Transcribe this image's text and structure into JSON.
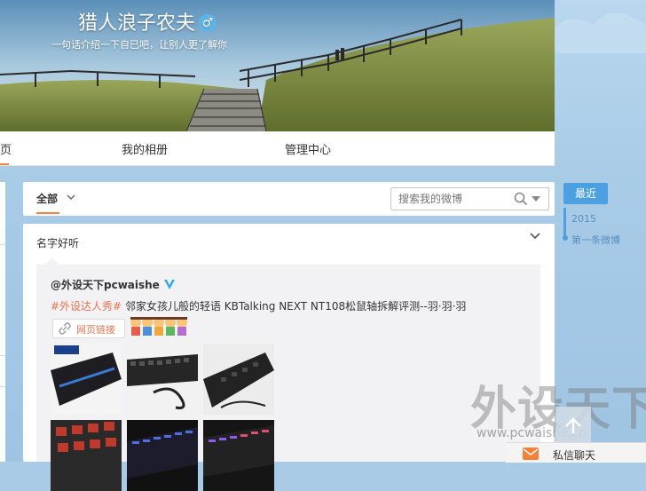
{
  "profile": {
    "nickname": "猎人浪子农夫",
    "gender_symbol": "♂",
    "bio": "一句话介绍一下自已吧，让别人更了解你"
  },
  "nav": {
    "tab_home_partial": "页",
    "tab_album": "我的相册",
    "tab_manage": "管理中心"
  },
  "filter": {
    "all_label": "全部",
    "search_placeholder": "搜索我的微博"
  },
  "card": {
    "group_title": "名字好听",
    "repost": {
      "author": "@外设天下pcwaishe",
      "hashtag": "#外设达人秀#",
      "text": " 邻家女孩儿般的轻语 KBTalking NEXT NT108松鼠轴拆解评测--羽·羽·羽",
      "link_label": "网页链接"
    }
  },
  "timeline": {
    "recent": "最近",
    "year": "2015",
    "first": "第一条微博"
  },
  "chat": {
    "label": "私信聊天"
  },
  "watermark": {
    "text": "外设天下",
    "url": "www.pcwaishe.cn"
  },
  "colors": {
    "accent": "#fa7d3c",
    "link": "#eb7350",
    "timeline": "#4aa0e0",
    "verified": "#2fa9f0"
  }
}
